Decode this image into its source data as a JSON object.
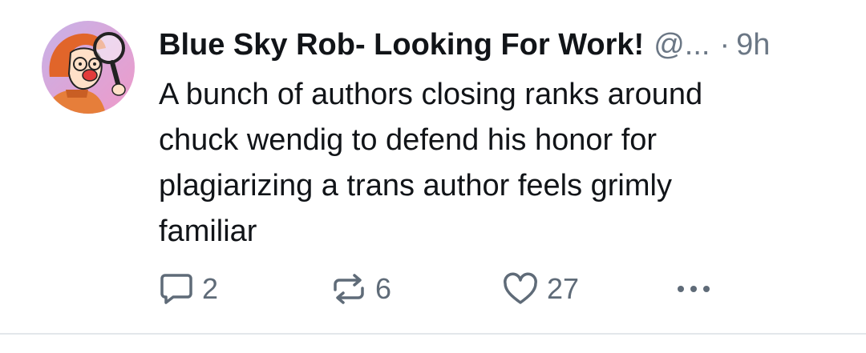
{
  "post": {
    "author_name": "Blue Sky Rob- Looking For Work!",
    "handle": "@...",
    "separator": "·",
    "timestamp": "9h",
    "text": "A bunch of authors closing ranks around\nchuck wendig to defend his honor for\nplagiarizing a trans author feels grimly\nfamiliar",
    "avatar": {
      "icon": "cartoon-person-with-magnifying-glass",
      "background": "#e8a6d6"
    }
  },
  "actions": {
    "reply": {
      "icon": "speech-bubble-icon",
      "count": "2"
    },
    "repost": {
      "icon": "repost-arrows-icon",
      "count": "6"
    },
    "like": {
      "icon": "heart-icon",
      "count": "27"
    },
    "more": {
      "icon": "ellipsis-icon"
    }
  },
  "colors": {
    "text_primary": "#111418",
    "text_secondary": "#6b7785",
    "icon": "#5f6b78",
    "divider": "#e3e7eb"
  }
}
